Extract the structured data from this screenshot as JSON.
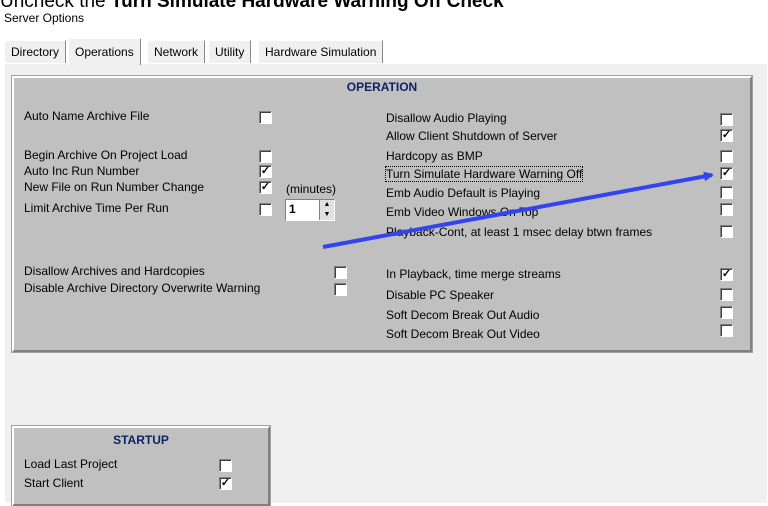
{
  "caption": {
    "prefix": "Uncheck the ",
    "bold": "Turn Simulate Hardware Warning Off",
    "suffix": " Check"
  },
  "window_title": "Server Options",
  "tabs": [
    "Directory",
    "Operations",
    "Network",
    "Utility",
    "Hardware Simulation"
  ],
  "active_tab": "Operations",
  "operation": {
    "title": "OPERATION",
    "minutes_label": "(minutes)",
    "spinner_value": "1",
    "left": [
      {
        "label": "Auto Name Archive File",
        "checked": false
      },
      {
        "label": "Begin Archive On Project Load",
        "checked": false
      },
      {
        "label": "Auto Inc Run Number",
        "checked": true
      },
      {
        "label": "New File on Run Number Change",
        "checked": true
      },
      {
        "label": "Limit Archive Time Per Run",
        "checked": false
      },
      {
        "label": "Disallow Archives and Hardcopies",
        "checked": false
      },
      {
        "label": "Disable Archive Directory Overwrite Warning",
        "checked": false
      }
    ],
    "right": [
      {
        "label": "Disallow Audio Playing",
        "checked": false
      },
      {
        "label": "Allow Client Shutdown of Server",
        "checked": true
      },
      {
        "label": "Hardcopy as BMP",
        "checked": false
      },
      {
        "label": "Turn Simulate Hardware Warning Off",
        "checked": true
      },
      {
        "label": "Emb Audio  Default is Playing",
        "checked": false
      },
      {
        "label": "Emb Video Windows On Top",
        "checked": false
      },
      {
        "label": "Playback-Cont, at least  1 msec delay btwn frames",
        "checked": false
      },
      {
        "label": "In Playback, time merge streams",
        "checked": true
      },
      {
        "label": "Disable PC Speaker",
        "checked": false
      },
      {
        "label": "Soft Decom Break Out Audio",
        "checked": false
      },
      {
        "label": "Soft Decom Break Out Video",
        "checked": false
      }
    ]
  },
  "startup": {
    "title": "STARTUP",
    "items": [
      {
        "label": "Load Last Project",
        "checked": false
      },
      {
        "label": "Start Client",
        "checked": true
      }
    ]
  },
  "colors": {
    "group_bg": "#c0c0c0",
    "title_blue": "#0a246a",
    "arrow": "#3344ee"
  },
  "check_glyph": "✓"
}
